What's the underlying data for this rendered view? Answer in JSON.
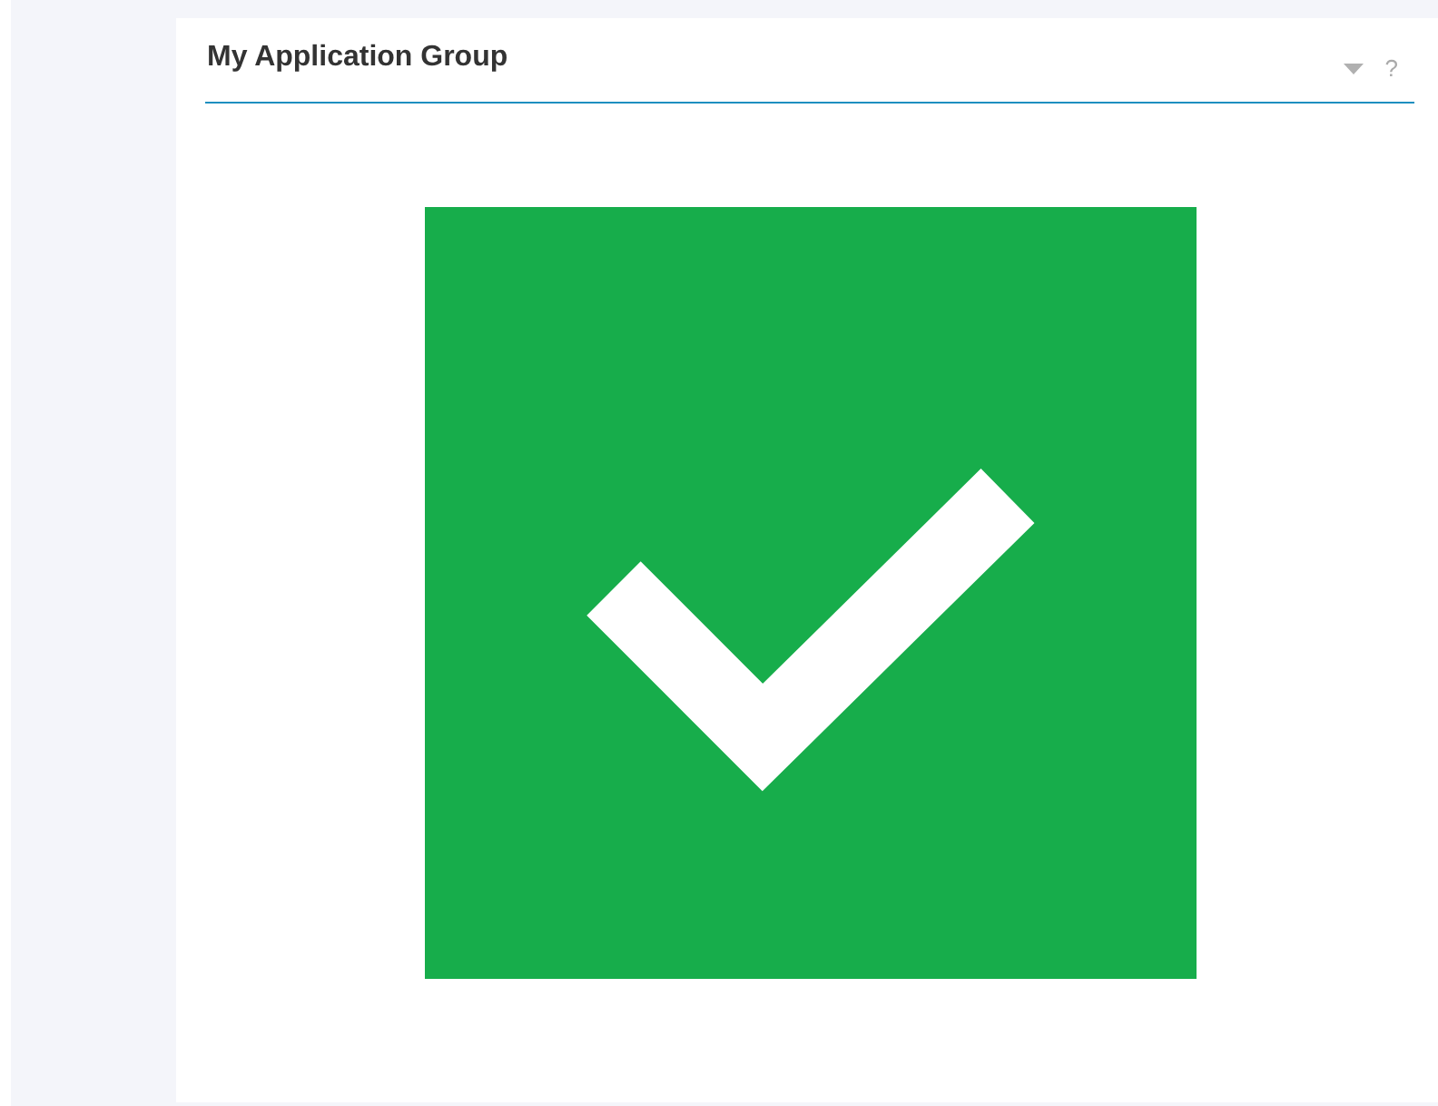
{
  "panel": {
    "title": "My Application Group",
    "help": "?",
    "status": {
      "kind": "ok"
    }
  }
}
